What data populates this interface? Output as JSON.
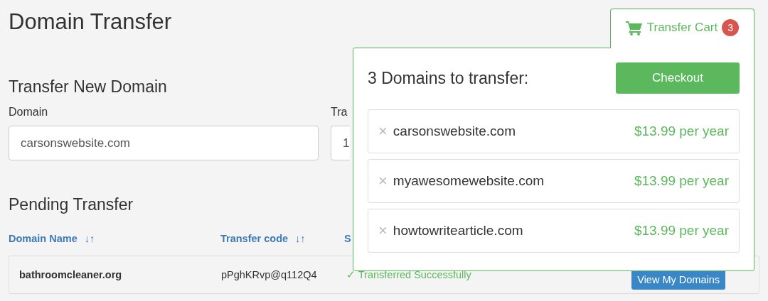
{
  "page_title": "Domain Transfer",
  "new_transfer": {
    "heading": "Transfer New Domain",
    "fields": [
      {
        "label": "Domain",
        "value": "carsonswebsite.com"
      },
      {
        "label": "Tra",
        "value": "1"
      }
    ]
  },
  "pending": {
    "heading": "Pending Transfer",
    "columns": [
      {
        "label": "Domain Name",
        "sort": "↓↑"
      },
      {
        "label": "Transfer code",
        "sort": "↓↑"
      },
      {
        "label": "S"
      }
    ],
    "rows": [
      {
        "domain": "bathroomcleaner.org",
        "code": "pPghKRvp@q112Q4",
        "status_icon": "✓",
        "status": "Transferred Successfully",
        "action": "View My Domains"
      }
    ]
  },
  "cart": {
    "tab_label": "Transfer Cart",
    "count": "3",
    "heading": "3 Domains to transfer:",
    "checkout": "Checkout",
    "items": [
      {
        "remove": "×",
        "domain": "carsonswebsite.com",
        "price": "$13.99 per year"
      },
      {
        "remove": "×",
        "domain": "myawesomewebsite.com",
        "price": "$13.99 per year"
      },
      {
        "remove": "×",
        "domain": "howtowritearticle.com",
        "price": "$13.99 per year"
      }
    ]
  }
}
